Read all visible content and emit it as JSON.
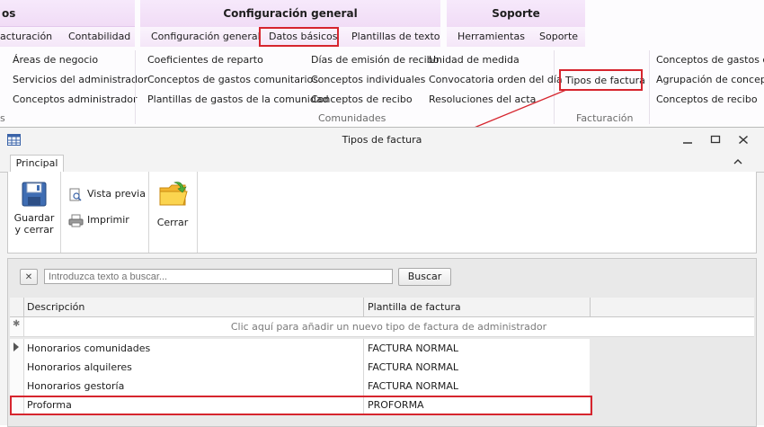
{
  "ribbon": {
    "groups": [
      "os",
      "Configuración general",
      "Soporte"
    ],
    "subtabs": [
      "acturación",
      "Contabilidad",
      "Configuración general",
      "Datos básicos",
      "Plantillas de texto",
      "Herramientas",
      "Soporte"
    ],
    "col1": [
      "Áreas de negocio",
      "Servicios del administrador",
      "Conceptos administrador"
    ],
    "col2": [
      "Coeficientes de reparto",
      "Conceptos de gastos comunitarios",
      "Plantillas de gastos de la comunidad"
    ],
    "col3": [
      "Días de emisión de recibo",
      "Conceptos individuales",
      "Conceptos de recibo"
    ],
    "col4": [
      "Unidad de medida",
      "Convocatoria orden del día",
      "Resoluciones del acta"
    ],
    "col5": [
      "Tipos de factura"
    ],
    "col6": [
      "Conceptos de gastos del",
      "Agrupación de conceptos",
      "Conceptos de recibo"
    ],
    "captions": [
      "s",
      "Comunidades",
      "Facturación"
    ]
  },
  "window": {
    "title": "Tipos de factura",
    "tab": "Principal",
    "toolbar": {
      "save_close": [
        "Guardar",
        "y cerrar"
      ],
      "preview": "Vista previa",
      "print": "Imprimir",
      "close": "Cerrar"
    },
    "search": {
      "placeholder": "Introduzca texto a buscar...",
      "button": "Buscar"
    },
    "grid": {
      "columns": [
        "Descripción",
        "Plantilla de factura"
      ],
      "new_row_hint": "Clic aquí para añadir un nuevo tipo de factura de administrador",
      "rows": [
        [
          "Honorarios comunidades",
          "FACTURA NORMAL"
        ],
        [
          "Honorarios alquileres",
          "FACTURA NORMAL"
        ],
        [
          "Honorarios gestoría",
          "FACTURA NORMAL"
        ],
        [
          "Proforma",
          "PROFORMA"
        ]
      ]
    }
  },
  "colors": {
    "highlight": "#d6252e",
    "ribbon_head": "#f1dcf6"
  }
}
